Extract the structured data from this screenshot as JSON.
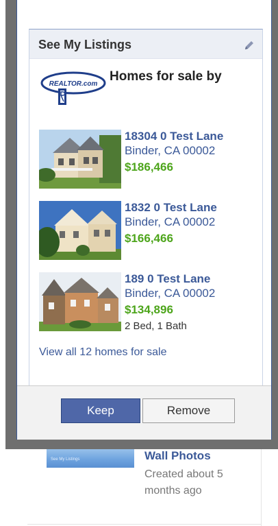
{
  "background": {
    "thumb_caption": "See My Listings",
    "title": "Wall Photos",
    "subtitle": "Created about 5 months ago"
  },
  "dialog": {
    "box_title": "See My Listings",
    "logo_text": "REALTOR.com",
    "heading": "Homes for sale by",
    "listings": [
      {
        "address": "18304 0 Test Lane",
        "city": "Binder, CA 00002",
        "price": "$186,466",
        "details": ""
      },
      {
        "address": "1832 0 Test Lane",
        "city": "Binder, CA 00002",
        "price": "$166,466",
        "details": ""
      },
      {
        "address": "189 0 Test Lane",
        "city": "Binder, CA 00002",
        "price": "$134,896",
        "details": "2 Bed, 1 Bath"
      }
    ],
    "view_all": "View all 12 homes for sale",
    "keep_label": "Keep",
    "remove_label": "Remove"
  },
  "colors": {
    "link": "#3b5998",
    "price": "#4da51b",
    "keep_button": "#4f67a8"
  }
}
